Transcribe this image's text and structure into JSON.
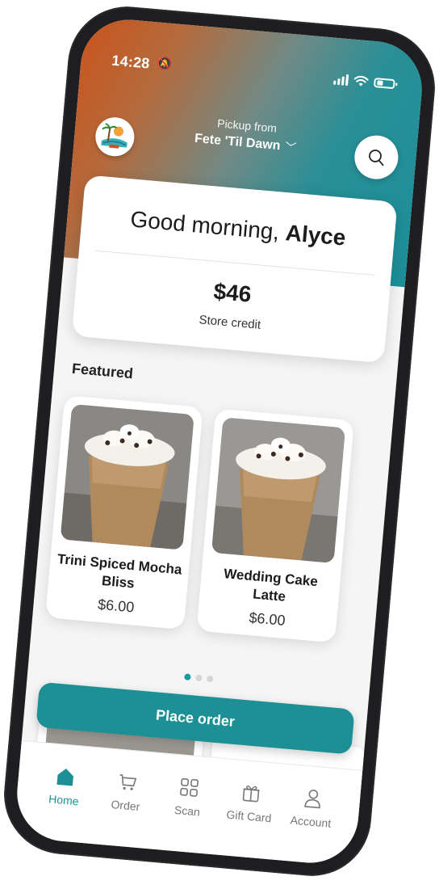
{
  "status_bar": {
    "time": "14:28"
  },
  "header": {
    "pickup_label": "Pickup from",
    "store_name": "Fete 'Til Dawn",
    "search_icon": "search-icon"
  },
  "greeting": {
    "prefix": "Good morning,",
    "name": "Alyce",
    "credit_amount": "$46",
    "credit_label": "Store credit"
  },
  "featured": {
    "title": "Featured",
    "items": [
      {
        "name": "Trini Spiced Mocha Bliss",
        "price": "$6.00"
      },
      {
        "name": "Wedding Cake Latte",
        "price": "$6.00"
      }
    ],
    "carousel": {
      "count": 3,
      "active_index": 0
    }
  },
  "actions": {
    "place_order_label": "Place order"
  },
  "tabs": [
    {
      "label": "Home",
      "icon": "home-icon",
      "active": true
    },
    {
      "label": "Order",
      "icon": "cart-icon",
      "active": false
    },
    {
      "label": "Scan",
      "icon": "qr-scan-icon",
      "active": false
    },
    {
      "label": "Gift Card",
      "icon": "gift-card-icon",
      "active": false
    },
    {
      "label": "Account",
      "icon": "account-icon",
      "active": false
    }
  ],
  "colors": {
    "accent": "#1d9095",
    "hero_orange": "#c9541d",
    "hero_teal": "#1b8f99"
  }
}
